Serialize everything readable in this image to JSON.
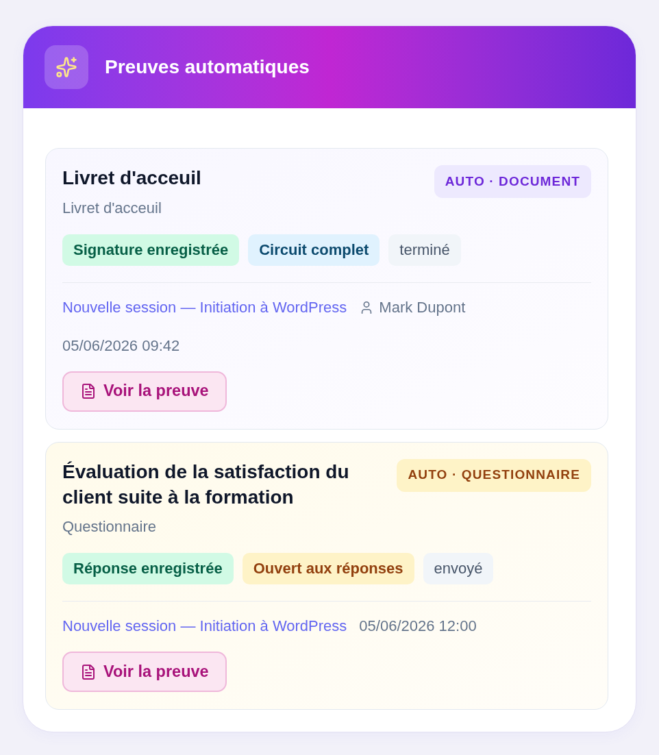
{
  "header": {
    "title": "Preuves automatiques"
  },
  "proofs": [
    {
      "kind": "document",
      "title": "Livret d'acceuil",
      "type_badge": "AUTO · DOCUMENT",
      "subtitle": "Livret d'acceuil",
      "chips": [
        {
          "label": "Signature enregistrée",
          "kind": "success"
        },
        {
          "label": "Circuit complet",
          "kind": "info"
        },
        {
          "label": "terminé",
          "kind": "neutral"
        }
      ],
      "session_link": "Nouvelle session — Initiation à WordPress",
      "person": "Mark Dupont",
      "date": "05/06/2026 09:42",
      "button": "Voir la preuve"
    },
    {
      "kind": "questionnaire",
      "title": "Évaluation de la satisfaction du client suite à la formation",
      "type_badge": "AUTO · QUESTIONNAIRE",
      "subtitle": "Questionnaire",
      "chips": [
        {
          "label": "Réponse enregistrée",
          "kind": "success"
        },
        {
          "label": "Ouvert aux réponses",
          "kind": "warning"
        },
        {
          "label": "envoyé",
          "kind": "neutral"
        }
      ],
      "session_link": "Nouvelle session — Initiation à WordPress",
      "date": "05/06/2026 12:00",
      "button": "Voir la preuve"
    }
  ]
}
